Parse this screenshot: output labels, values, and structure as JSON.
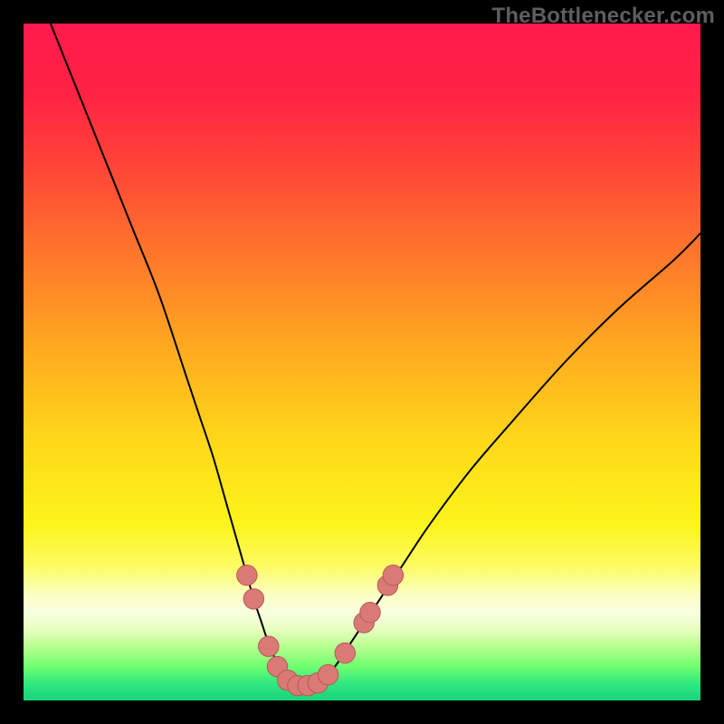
{
  "watermark": "TheBottlenecker.com",
  "colors": {
    "frame": "#000000",
    "watermark": "#5e5e5e",
    "gradient_stops": [
      {
        "offset": 0.0,
        "color": "#ff1a4c"
      },
      {
        "offset": 0.1,
        "color": "#ff2244"
      },
      {
        "offset": 0.22,
        "color": "#ff4836"
      },
      {
        "offset": 0.35,
        "color": "#ff7a2a"
      },
      {
        "offset": 0.48,
        "color": "#ffaa20"
      },
      {
        "offset": 0.62,
        "color": "#ffd91a"
      },
      {
        "offset": 0.74,
        "color": "#fcf41a"
      },
      {
        "offset": 0.8,
        "color": "#fcfc62"
      },
      {
        "offset": 0.845,
        "color": "#fbffc5"
      },
      {
        "offset": 0.87,
        "color": "#f8ffe0"
      },
      {
        "offset": 0.895,
        "color": "#e8ffc0"
      },
      {
        "offset": 0.92,
        "color": "#b8ff90"
      },
      {
        "offset": 0.95,
        "color": "#70ff70"
      },
      {
        "offset": 0.975,
        "color": "#30e880"
      },
      {
        "offset": 1.0,
        "color": "#18d47a"
      }
    ],
    "curve": "#000000",
    "marker_fill": "#d97a77",
    "marker_stroke": "#b85852"
  },
  "chart_data": {
    "type": "line",
    "title": "",
    "xlabel": "",
    "ylabel": "",
    "xlim": [
      0,
      100
    ],
    "ylim": [
      0,
      100
    ],
    "series": [
      {
        "name": "bottleneck-curve",
        "x": [
          4,
          8,
          12,
          16,
          20,
          24,
          26,
          28,
          30,
          32,
          33,
          34,
          35,
          36,
          37,
          38,
          39,
          40,
          41,
          42,
          43,
          44,
          46,
          48,
          52,
          56,
          60,
          66,
          72,
          80,
          88,
          96,
          100
        ],
        "y": [
          100,
          90,
          80,
          70,
          60,
          48,
          42,
          36,
          29,
          22,
          18.5,
          15,
          12,
          9,
          6.5,
          4.5,
          3,
          2.2,
          2,
          2,
          2.3,
          3,
          5,
          8,
          14,
          20,
          26,
          34,
          41,
          50,
          58,
          65,
          69
        ]
      }
    ],
    "markers": {
      "name": "bottleneck-markers",
      "points": [
        {
          "x": 33.0,
          "y": 18.5
        },
        {
          "x": 34.0,
          "y": 15.0
        },
        {
          "x": 36.2,
          "y": 8.0
        },
        {
          "x": 37.5,
          "y": 5.0
        },
        {
          "x": 39.0,
          "y": 3.0
        },
        {
          "x": 40.5,
          "y": 2.2
        },
        {
          "x": 42.0,
          "y": 2.2
        },
        {
          "x": 43.5,
          "y": 2.6
        },
        {
          "x": 45.0,
          "y": 3.8
        },
        {
          "x": 47.5,
          "y": 7.0
        },
        {
          "x": 50.3,
          "y": 11.5
        },
        {
          "x": 51.2,
          "y": 13.0
        },
        {
          "x": 53.8,
          "y": 17.0
        },
        {
          "x": 54.6,
          "y": 18.5
        }
      ],
      "radius_data_units": 1.5
    },
    "grid": false,
    "legend": false
  }
}
